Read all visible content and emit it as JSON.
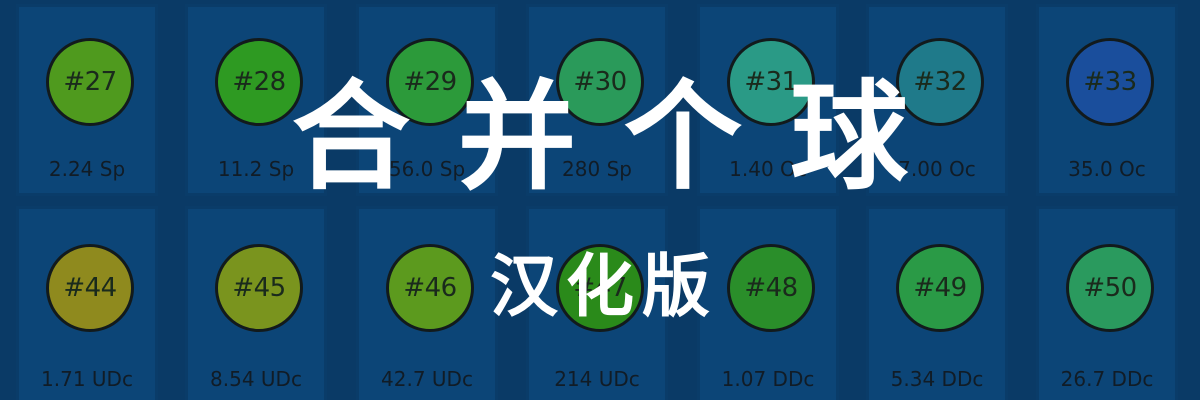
{
  "title": "合并个球",
  "subtitle": "汉化版",
  "rows": [
    [
      {
        "label": "#27",
        "value": "2.24 Sp",
        "color": "#4f9a1e"
      },
      {
        "label": "#28",
        "value": "11.2 Sp",
        "color": "#2e9a22"
      },
      {
        "label": "#29",
        "value": "56.0 Sp",
        "color": "#2c9a3a"
      },
      {
        "label": "#30",
        "value": "280 Sp",
        "color": "#2a9a5a"
      },
      {
        "label": "#31",
        "value": "1.40 Oc",
        "color": "#2a9a86"
      },
      {
        "label": "#32",
        "value": "7.00 Oc",
        "color": "#1f7a8a"
      },
      {
        "label": "#33",
        "value": "35.0 Oc",
        "color": "#1a4e9c"
      }
    ],
    [
      {
        "label": "#44",
        "value": "1.71 UDc",
        "color": "#8f8a1e"
      },
      {
        "label": "#45",
        "value": "8.54 UDc",
        "color": "#7a941e"
      },
      {
        "label": "#46",
        "value": "42.7 UDc",
        "color": "#5c9a1e"
      },
      {
        "label": "#47",
        "value": "214 UDc",
        "color": "#2a8a1a"
      },
      {
        "label": "#48",
        "value": "1.07 DDc",
        "color": "#2a8e2a"
      },
      {
        "label": "#49",
        "value": "5.34 DDc",
        "color": "#2a9a46"
      },
      {
        "label": "#50",
        "value": "26.7 DDc",
        "color": "#2a9a5e"
      }
    ]
  ]
}
